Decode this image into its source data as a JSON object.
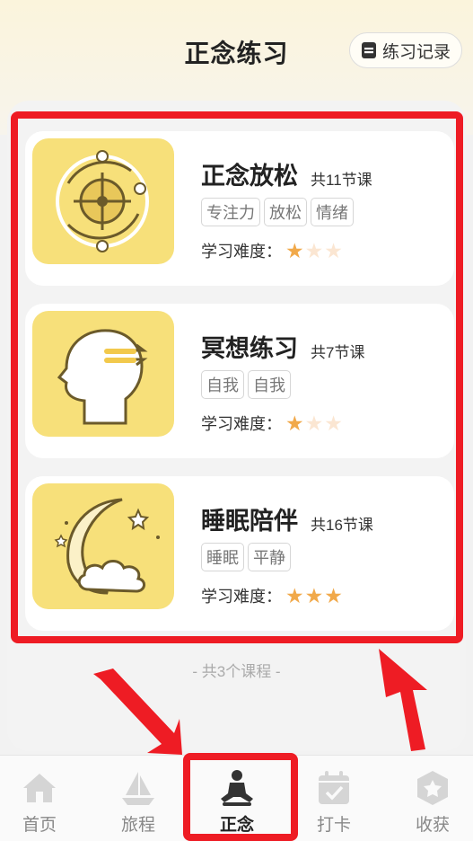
{
  "header": {
    "title": "正念练习",
    "record_button": "练习记录"
  },
  "difficulty_label": "学习难度：",
  "courses": [
    {
      "title": "正念放松",
      "lessons": "共11节课",
      "tags": [
        "专注力",
        "放松",
        "情绪"
      ],
      "difficulty": 1,
      "max_difficulty": 3,
      "illustration": "focus-target-icon"
    },
    {
      "title": "冥想练习",
      "lessons": "共7节课",
      "tags": [
        "自我",
        "自我"
      ],
      "difficulty": 1,
      "max_difficulty": 3,
      "illustration": "meditation-head-icon"
    },
    {
      "title": "睡眠陪伴",
      "lessons": "共16节课",
      "tags": [
        "睡眠",
        "平静"
      ],
      "difficulty": 3,
      "max_difficulty": 3,
      "illustration": "moon-cloud-icon"
    }
  ],
  "footer_text": "- 共3个课程 -",
  "nav": [
    {
      "label": "首页",
      "icon": "home-icon"
    },
    {
      "label": "旅程",
      "icon": "sailboat-icon"
    },
    {
      "label": "正念",
      "icon": "meditation-icon",
      "active": true
    },
    {
      "label": "打卡",
      "icon": "calendar-check-icon"
    },
    {
      "label": "收获",
      "icon": "hexagon-star-icon"
    }
  ],
  "colors": {
    "accent": "#f7e07a",
    "star_on": "#f1a94a",
    "star_off": "#fbe6d2",
    "annotation": "#ee1c24"
  }
}
